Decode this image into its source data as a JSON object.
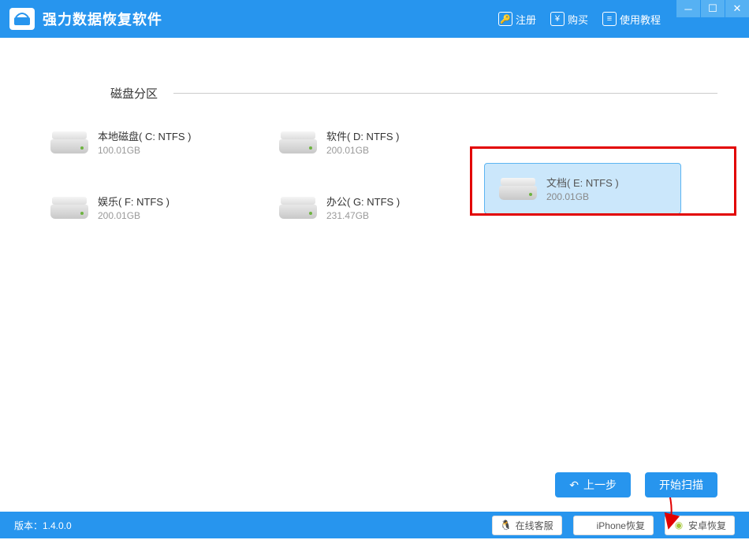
{
  "app": {
    "title": "强力数据恢复软件"
  },
  "header": {
    "register": "注册",
    "buy": "购买",
    "tutorial": "使用教程"
  },
  "section": {
    "title": "磁盘分区"
  },
  "partitions": [
    {
      "name": "本地磁盘( C: NTFS )",
      "size": "100.01GB",
      "selected": false
    },
    {
      "name": "软件( D: NTFS )",
      "size": "200.01GB",
      "selected": false
    },
    {
      "name": "文档( E: NTFS )",
      "size": "200.01GB",
      "selected": true
    },
    {
      "name": "娱乐( F: NTFS )",
      "size": "200.01GB",
      "selected": false
    },
    {
      "name": "办公( G: NTFS )",
      "size": "231.47GB",
      "selected": false
    }
  ],
  "actions": {
    "prev": "上一步",
    "scan": "开始扫描"
  },
  "footer": {
    "version_label": "版本：1.4.0.0",
    "online_service": "在线客服",
    "iphone_recovery": "iPhone恢复",
    "android_recovery": "安卓恢复"
  }
}
